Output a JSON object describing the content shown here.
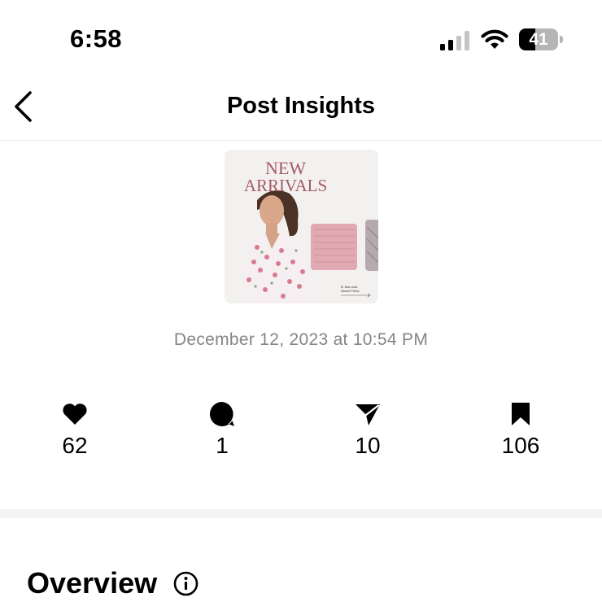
{
  "status_bar": {
    "time": "6:58",
    "battery_level": "41",
    "battery_fraction": 0.41,
    "signal_bars_active": 2,
    "signal_bars_total": 4
  },
  "header": {
    "title": "Post Insights",
    "back_icon": "chevron-left-icon"
  },
  "post": {
    "thumbnail": {
      "headline_line1": "NEW",
      "headline_line2": "ARRIVALS",
      "caption_line1": "B. Bar-mod",
      "caption_line2": "Sweet Prints",
      "accent_color": "#a55a64"
    },
    "date": "December 12, 2023 at 10:54 PM"
  },
  "stats": [
    {
      "icon": "heart-icon",
      "value": "62"
    },
    {
      "icon": "comment-icon",
      "value": "1"
    },
    {
      "icon": "share-icon",
      "value": "10"
    },
    {
      "icon": "bookmark-icon",
      "value": "106"
    }
  ],
  "overview": {
    "title": "Overview",
    "info_icon": "info-icon"
  }
}
